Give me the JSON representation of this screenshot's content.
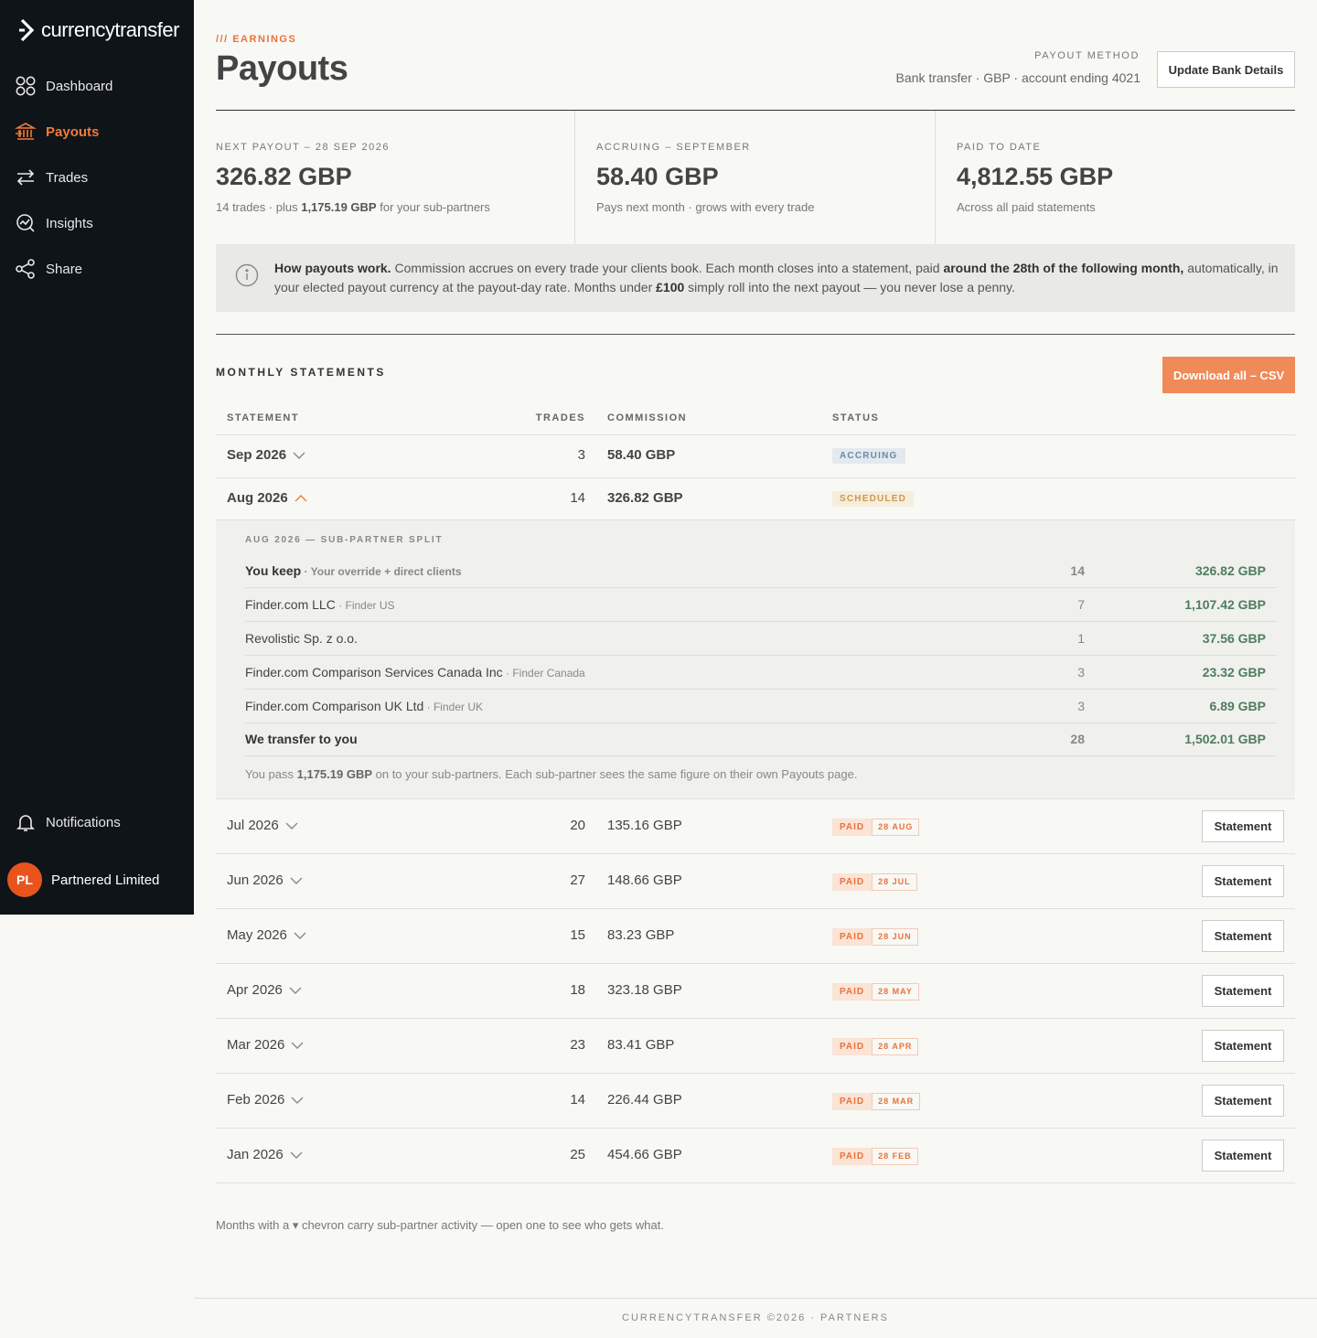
{
  "brand": {
    "name": "currencytransfer",
    "accent": "#f07a3a",
    "sidebar_bg": "#0f1419"
  },
  "sidebar": {
    "items": [
      {
        "label": "Dashboard",
        "icon": "grid-icon"
      },
      {
        "label": "Payouts",
        "icon": "bank-icon",
        "active": true
      },
      {
        "label": "Trades",
        "icon": "arrows-icon"
      },
      {
        "label": "Insights",
        "icon": "chart-icon"
      },
      {
        "label": "Share",
        "icon": "share-icon"
      }
    ],
    "notifications": "Notifications",
    "user": {
      "initials": "PL",
      "name": "Partnered Limited"
    }
  },
  "header": {
    "eyebrow": "/// EARNINGS",
    "title": "Payouts",
    "payout_method_label": "PAYOUT METHOD",
    "payout_method_value": "Bank transfer · GBP · account ending 4021",
    "update_button": "Update Bank Details"
  },
  "stats": [
    {
      "label": "NEXT PAYOUT – 28 SEP 2026",
      "value": "326.82 GBP",
      "sub_pre": "14 trades · plus ",
      "sub_bold": "1,175.19 GBP",
      "sub_post": " for your sub-partners"
    },
    {
      "label": "ACCRUING – SEPTEMBER",
      "value": "58.40 GBP",
      "sub": "Pays next month · grows with every trade"
    },
    {
      "label": "PAID TO DATE",
      "value": "4,812.55 GBP",
      "sub": "Across all paid statements"
    }
  ],
  "info": {
    "bold1": "How payouts work.",
    "text1": " Commission accrues on every trade your clients book. Each month closes into a statement, paid ",
    "bold2": "around the 28th of the following month,",
    "text2": " automatically, in your elected payout currency at the payout-day rate. Months under ",
    "bold3": "£100",
    "text3": " simply roll into the next payout — you never lose a penny."
  },
  "statements": {
    "title": "MONTHLY STATEMENTS",
    "download_button": "Download all – CSV",
    "columns": {
      "statement": "STATEMENT",
      "trades": "TRADES",
      "commission": "COMMISSION",
      "status": "STATUS"
    },
    "open_rows": [
      {
        "month": "Sep 2026",
        "trades": "3",
        "commission": "58.40 GBP",
        "status": "ACCRUING"
      },
      {
        "month": "Aug 2026",
        "trades": "14",
        "commission": "326.82 GBP",
        "status": "SCHEDULED"
      }
    ],
    "split": {
      "title": "AUG 2026 — SUB-PARTNER SPLIT",
      "rows": [
        {
          "name": "You keep",
          "note": " · Your override + direct clients",
          "trades": "14",
          "amount": "326.82 GBP"
        },
        {
          "name": "Finder.com LLC",
          "note": " · Finder US",
          "trades": "7",
          "amount": "1,107.42 GBP"
        },
        {
          "name": "Revolistic Sp. z o.o.",
          "note": "",
          "trades": "1",
          "amount": "37.56 GBP"
        },
        {
          "name": "Finder.com Comparison Services Canada Inc",
          "note": " · Finder Canada",
          "trades": "3",
          "amount": "23.32 GBP"
        },
        {
          "name": "Finder.com Comparison UK Ltd",
          "note": " · Finder UK",
          "trades": "3",
          "amount": "6.89 GBP"
        },
        {
          "name": "We transfer to you",
          "note": "",
          "trades": "28",
          "amount": "1,502.01 GBP"
        }
      ],
      "note_pre": "You pass ",
      "note_bold": "1,175.19 GBP",
      "note_post": " on to your sub-partners. Each sub-partner sees the same figure on their own Payouts page."
    },
    "paid_rows": [
      {
        "month": "Jul 2026",
        "trades": "20",
        "commission": "135.16 GBP",
        "status": "PAID",
        "date": "28 AUG",
        "button": "Statement"
      },
      {
        "month": "Jun 2026",
        "trades": "27",
        "commission": "148.66 GBP",
        "status": "PAID",
        "date": "28 JUL",
        "button": "Statement"
      },
      {
        "month": "May 2026",
        "trades": "15",
        "commission": "83.23 GBP",
        "status": "PAID",
        "date": "28 JUN",
        "button": "Statement"
      },
      {
        "month": "Apr 2026",
        "trades": "18",
        "commission": "323.18 GBP",
        "status": "PAID",
        "date": "28 MAY",
        "button": "Statement"
      },
      {
        "month": "Mar 2026",
        "trades": "23",
        "commission": "83.41 GBP",
        "status": "PAID",
        "date": "28 APR",
        "button": "Statement"
      },
      {
        "month": "Feb 2026",
        "trades": "14",
        "commission": "226.44 GBP",
        "status": "PAID",
        "date": "28 MAR",
        "button": "Statement"
      },
      {
        "month": "Jan 2026",
        "trades": "25",
        "commission": "454.66 GBP",
        "status": "PAID",
        "date": "28 FEB",
        "button": "Statement"
      }
    ],
    "footnote": "Months with a ▾ chevron carry sub-partner activity — open one to see who gets what."
  },
  "footer": "CURRENCYTRANSFER ©2026 · PARTNERS"
}
